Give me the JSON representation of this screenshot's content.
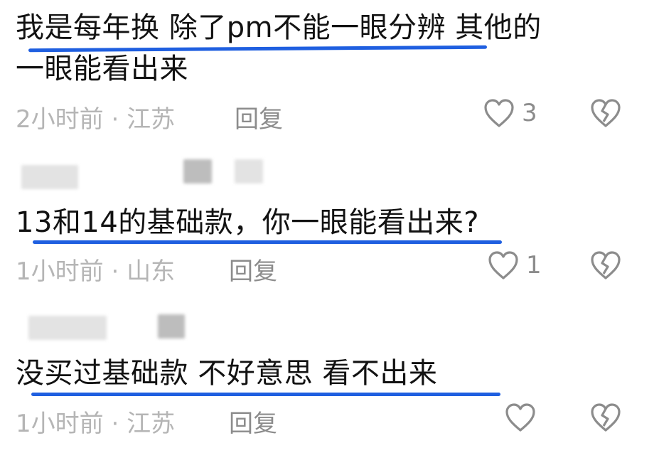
{
  "comments": [
    {
      "text_line1": "我是每年换 除了pm不能一眼分辨 其他的",
      "text_line2": "一眼能看出来",
      "time": "2小时前",
      "sep": "·",
      "location": "江苏",
      "reply": "回复",
      "likes": "3"
    },
    {
      "text_line1": "13和14的基础款，你一眼能看出来?",
      "time": "1小时前",
      "sep": "·",
      "location": "山东",
      "reply": "回复",
      "likes": "1"
    },
    {
      "text_line1": "没买过基础款 不好意思 看不出来",
      "time": "1小时前",
      "sep": "·",
      "location": "江苏",
      "reply": "回复",
      "likes": ""
    }
  ],
  "colors": {
    "underline": "#1f5fe0",
    "meta": "#b5b5b5",
    "action": "#8c8c8c"
  },
  "icons": {
    "like": "heart-icon",
    "dislike": "broken-heart-icon"
  }
}
